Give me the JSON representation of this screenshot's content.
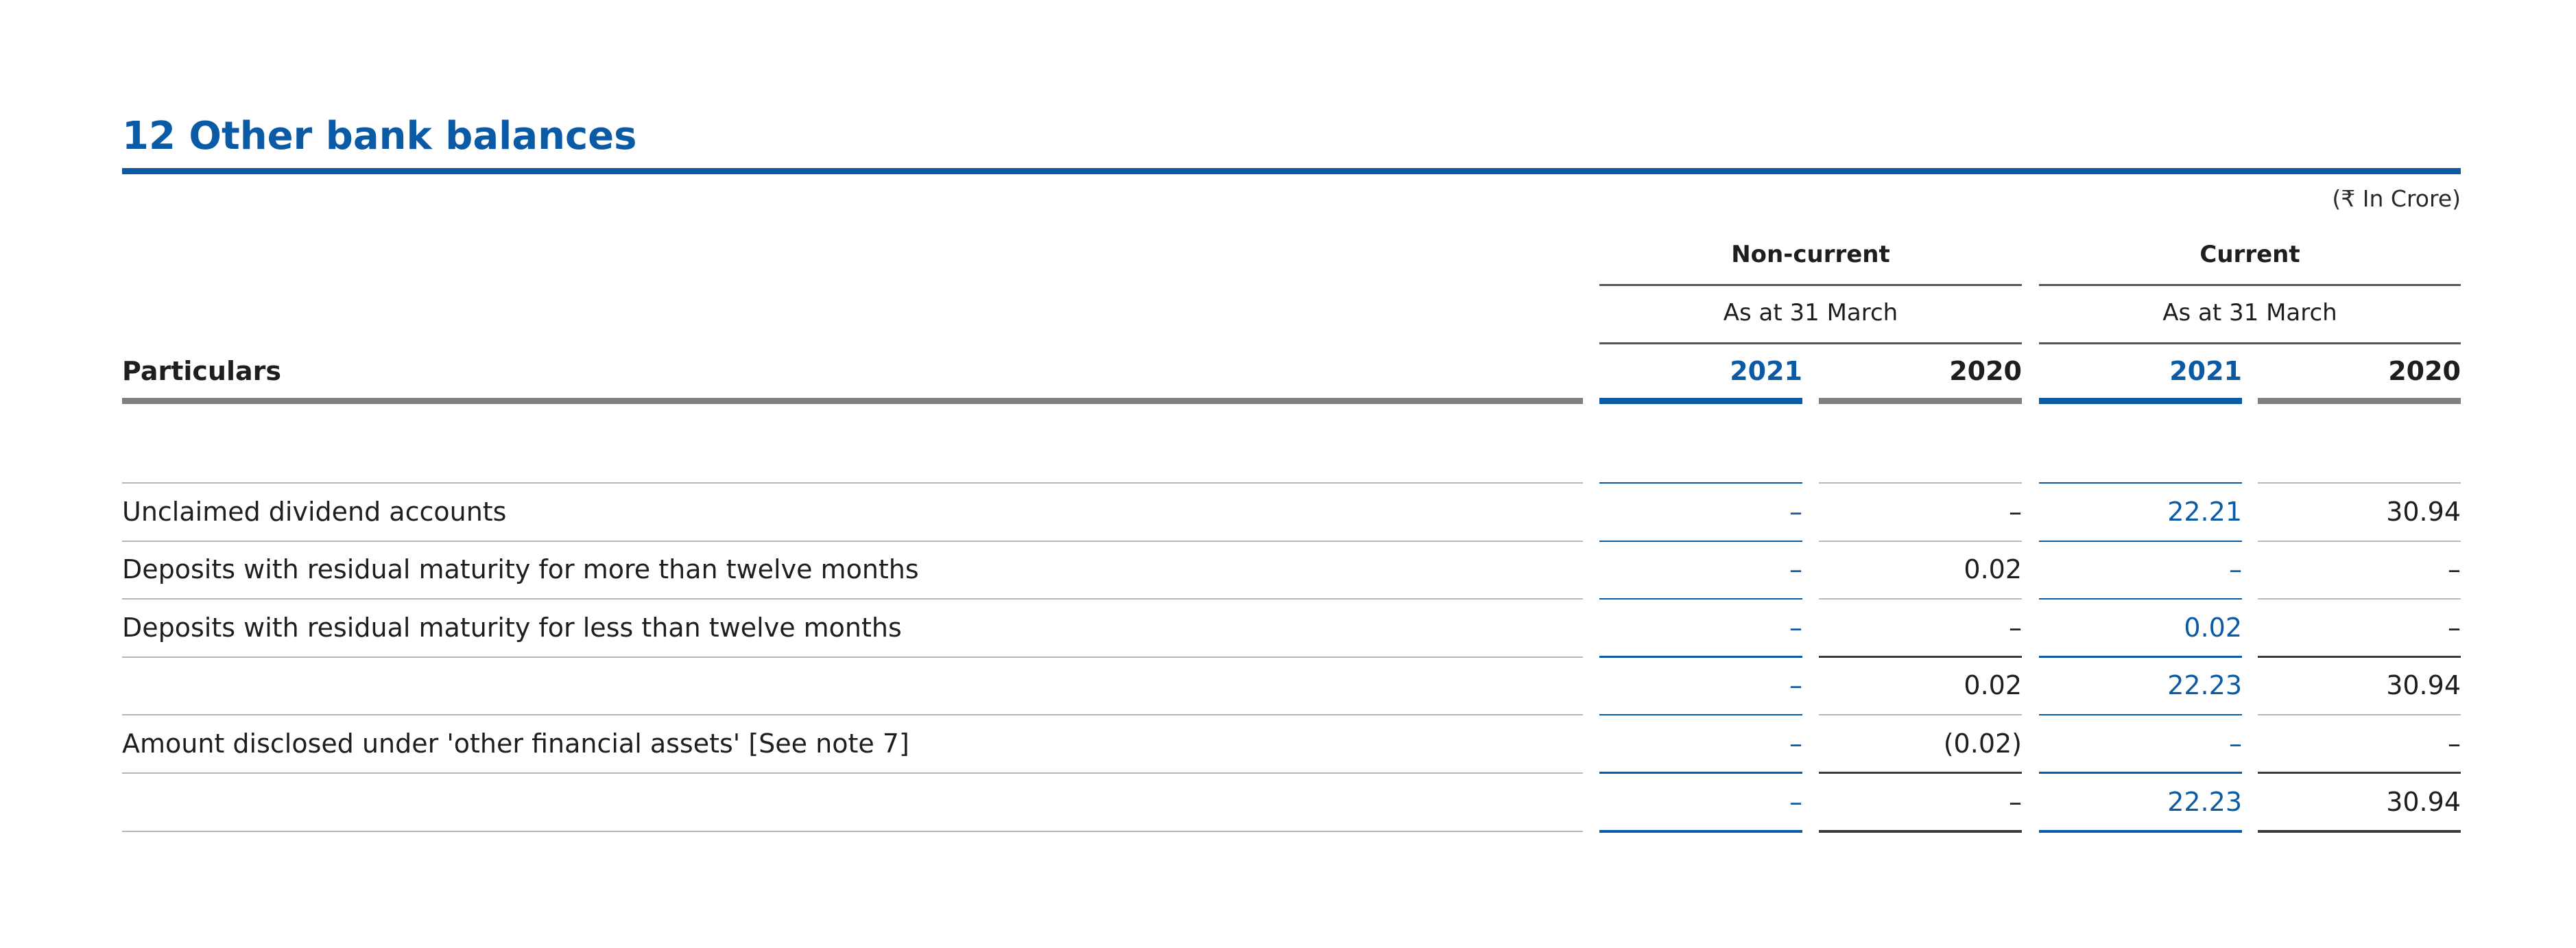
{
  "note": {
    "title": "12 Other bank balances",
    "unit": "(₹ In Crore)"
  },
  "header": {
    "particulars": "Particulars",
    "groups": [
      {
        "label": "Non-current",
        "sub": "As at 31 March",
        "years": [
          "2021",
          "2020"
        ]
      },
      {
        "label": "Current",
        "sub": "As at 31 March",
        "years": [
          "2021",
          "2020"
        ]
      }
    ]
  },
  "rows": [
    {
      "label": "Unclaimed dividend accounts",
      "values": [
        "–",
        "–",
        "22.21",
        "30.94"
      ]
    },
    {
      "label": "Deposits with residual maturity for more than twelve months",
      "values": [
        "–",
        "0.02",
        "–",
        "–"
      ]
    },
    {
      "label": "Deposits with residual maturity for less than twelve months",
      "values": [
        "–",
        "–",
        "0.02",
        "–"
      ]
    },
    {
      "label": "",
      "values": [
        "–",
        "0.02",
        "22.23",
        "30.94"
      ]
    },
    {
      "label": "Amount disclosed under 'other financial assets' [See note 7]",
      "values": [
        "–",
        "(0.02)",
        "–",
        "–"
      ]
    },
    {
      "label": "",
      "values": [
        "–",
        "–",
        "22.23",
        "30.94"
      ]
    }
  ],
  "colors": {
    "accent": "#0b5aa6",
    "text": "#1e1e1e",
    "rule_gray": "#808080"
  }
}
